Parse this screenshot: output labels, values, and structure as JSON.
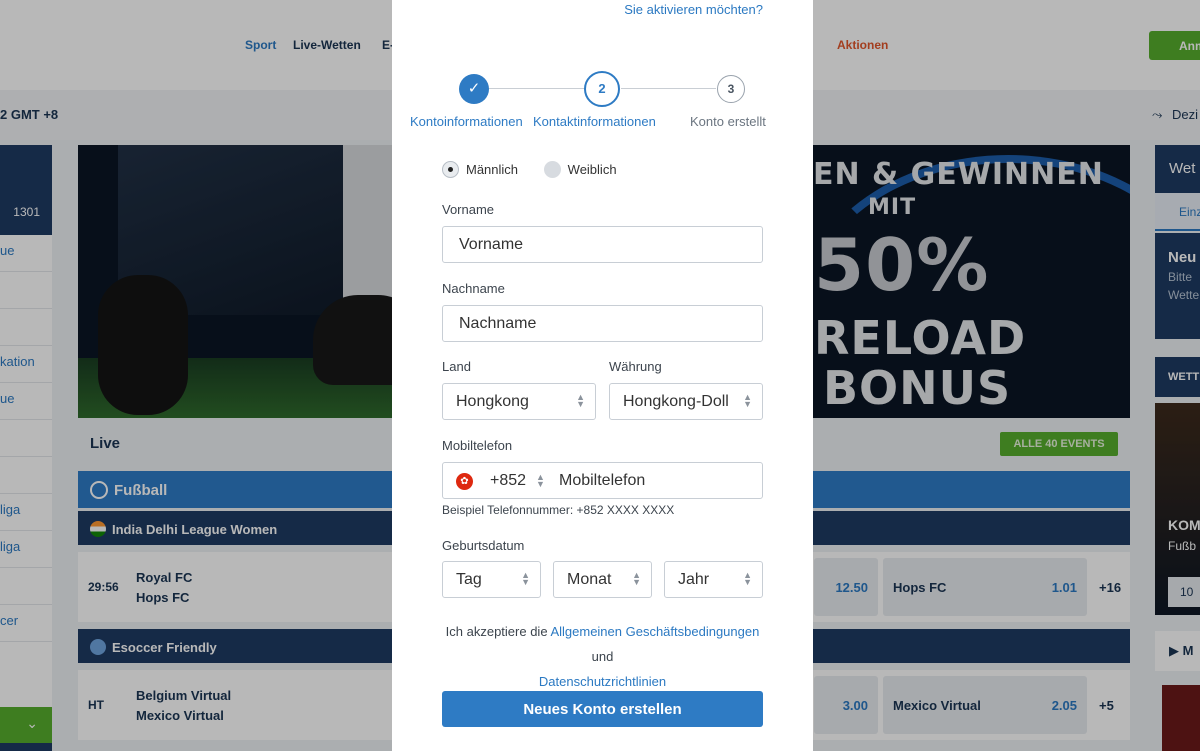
{
  "background": {
    "nav": {
      "sport": "Sport",
      "live": "Live-Wetten",
      "e": "E-",
      "aktionen": "Aktionen",
      "login": "Anm"
    },
    "timezone": "2 GMT +8",
    "dez": "Dezi",
    "left": {
      "count": "1301",
      "items": [
        "ue",
        "",
        "",
        "kation",
        "ue",
        "",
        "",
        "liga",
        "liga",
        "",
        "cer"
      ]
    },
    "banner": {
      "line1": "EN & GEWINNEN",
      "line2": "MIT",
      "line3": "50%",
      "line4": "RELOAD",
      "line5": "BONUS"
    },
    "live_title": "Live",
    "all_events": "ALLE 40 EVENTS",
    "sport": "Fußball",
    "leagues": [
      {
        "name": "India Delhi League Women",
        "match": {
          "time": "29:56",
          "team1": "Royal FC",
          "team2": "Hops FC",
          "odd1": "12.50",
          "team_b": "Hops FC",
          "odd2": "1.01",
          "more": "+16"
        }
      },
      {
        "name": "Esoccer Friendly",
        "match": {
          "time": "HT",
          "team1": "Belgium Virtual",
          "team2": "Mexico Virtual",
          "odd1": "3.00",
          "team_b": "Mexico Virtual",
          "odd2": "2.05",
          "more": "+5"
        }
      }
    ],
    "right": {
      "head": "Wet",
      "tab": "Einz",
      "card_title": "Neu",
      "card_l1": "Bitte",
      "card_l2": "Wette",
      "wett": "WETT",
      "img_title": "KOM",
      "img_sub": "Fußb",
      "img_box": "10",
      "play": "M"
    }
  },
  "modal": {
    "activate_text": "Sie aktivieren möchten?",
    "steps": [
      {
        "label": "Kontoinformationen",
        "marker": "✓"
      },
      {
        "label": "Kontaktinformationen",
        "marker": "2"
      },
      {
        "label": "Konto erstellt",
        "marker": "3"
      }
    ],
    "gender": {
      "male": "Männlich",
      "female": "Weiblich"
    },
    "first_name": {
      "label": "Vorname",
      "placeholder": "Vorname"
    },
    "last_name": {
      "label": "Nachname",
      "placeholder": "Nachname"
    },
    "country": {
      "label": "Land",
      "value": "Hongkong"
    },
    "currency": {
      "label": "Währung",
      "value": "Hongkong-Doll"
    },
    "phone": {
      "label": "Mobiltelefon",
      "code": "+852",
      "placeholder": "Mobiltelefon",
      "example": "Beispiel Telefonnummer: +852 XXXX XXXX"
    },
    "birthdate": {
      "label": "Geburtsdatum",
      "day": "Tag",
      "month": "Monat",
      "year": "Jahr"
    },
    "terms": {
      "prefix": "Ich akzeptiere die ",
      "link1": "Allgemeinen Geschäftsbedingungen",
      "middle": " und",
      "link2": "Datenschutzrichtlinien"
    },
    "submit": "Neues Konto erstellen"
  },
  "colors": {
    "primary": "#2e7bc4",
    "navy": "#1e3b63",
    "green": "#56ad2d",
    "accent": "#e2572b"
  }
}
